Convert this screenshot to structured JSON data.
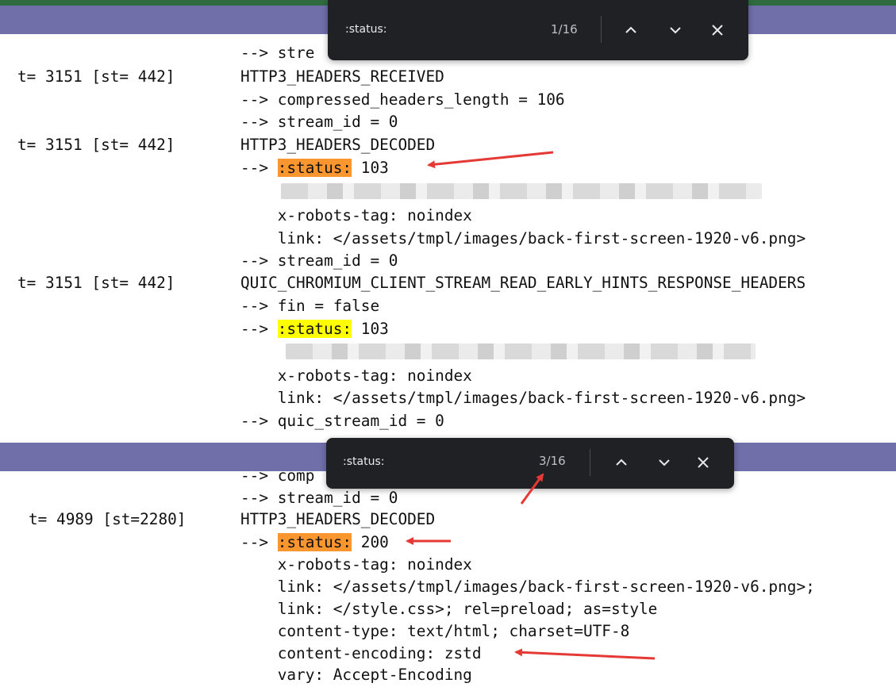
{
  "find_bar_1": {
    "query": ":status:",
    "count": "1/16"
  },
  "find_bar_2": {
    "query": ":status:",
    "count": "3/16"
  },
  "colors": {
    "highlight_active": "#f9962f",
    "highlight_match": "#ffff00",
    "find_bar_bg": "#202124",
    "header_bar": "#706faa",
    "top_strip": "#2f6b3e",
    "annotation_arrow": "#e53935"
  },
  "log1": {
    "l0": "--> stre",
    "l1": {
      "ts": "t= 3151 [st= 442]",
      "event": "HTTP3_HEADERS_RECEIVED"
    },
    "l2": "--> compressed_headers_length = 106",
    "l3": "--> stream_id = 0",
    "l4": {
      "ts": "t= 3151 [st= 442]",
      "event": "HTTP3_HEADERS_DECODED"
    },
    "l5": {
      "prefix": "--> ",
      "match": ":status:",
      "value": " 103"
    },
    "l7": "    x-robots-tag: noindex",
    "l8": "    link: </assets/tmpl/images/back-first-screen-1920-v6.png>",
    "l9": "--> stream_id = 0",
    "l10": {
      "ts": "t= 3151 [st= 442]",
      "event": "QUIC_CHROMIUM_CLIENT_STREAM_READ_EARLY_HINTS_RESPONSE_HEADERS"
    },
    "l11": "--> fin = false",
    "l12": {
      "prefix": "--> ",
      "match": ":status:",
      "value": " 103"
    },
    "l14": "    x-robots-tag: noindex",
    "l15": "    link: </assets/tmpl/images/back-first-screen-1920-v6.png>",
    "l16": "--> quic_stream_id = 0"
  },
  "log2": {
    "l0": "--> comp",
    "l1": "--> stream_id = 0",
    "l2": {
      "ts": "t= 4989 [st=2280]",
      "event": "HTTP3_HEADERS_DECODED"
    },
    "l3": {
      "prefix": "--> ",
      "match": ":status:",
      "value": " 200"
    },
    "l4": "    x-robots-tag: noindex",
    "l5": "    link: </assets/tmpl/images/back-first-screen-1920-v6.png>;",
    "l6": "    link: </style.css>; rel=preload; as=style",
    "l7": "    content-type: text/html; charset=UTF-8",
    "l8": "    content-encoding: zstd",
    "l9": "    vary: Accept-Encoding"
  }
}
